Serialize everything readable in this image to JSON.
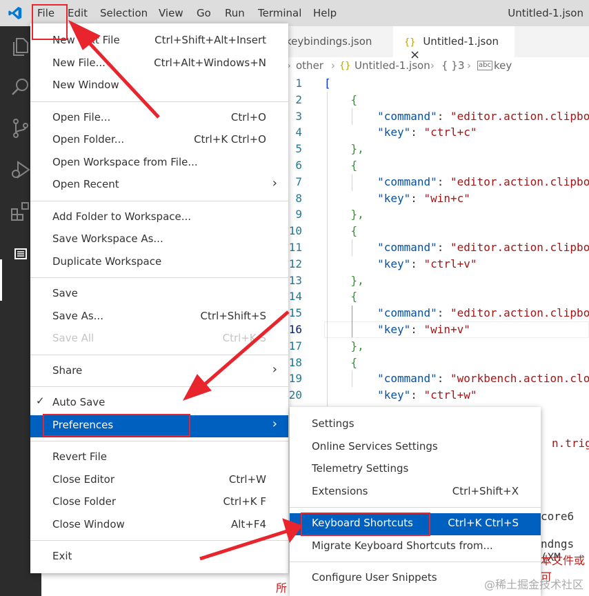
{
  "menubar": {
    "items": [
      "File",
      "Edit",
      "Selection",
      "View",
      "Go",
      "Run",
      "Terminal",
      "Help"
    ],
    "window_title": "Untitled-1.json"
  },
  "tabs": [
    {
      "label": "keybindings.json"
    },
    {
      "label": "Untitled-1.json",
      "icon_text": "{}",
      "close": "×"
    }
  ],
  "breadcrumb": {
    "items": [
      "other",
      "Untitled-1.json",
      "3",
      "key"
    ],
    "file_icon": "{}",
    "obj_icon": "{ }",
    "key_icon": "abc"
  },
  "editor": {
    "lines": [
      {
        "n": "1",
        "text": "["
      },
      {
        "n": "2",
        "text": "    {"
      },
      {
        "n": "3",
        "key": "\"command\"",
        "val": "\"editor.action.clipbo"
      },
      {
        "n": "4",
        "key": "\"key\"",
        "val": "\"ctrl+c\""
      },
      {
        "n": "5",
        "text": "    },"
      },
      {
        "n": "6",
        "text": "    {"
      },
      {
        "n": "7",
        "key": "\"command\"",
        "val": "\"editor.action.clipbo"
      },
      {
        "n": "8",
        "key": "\"key\"",
        "val": "\"win+c\""
      },
      {
        "n": "9",
        "text": "    },"
      },
      {
        "n": "10",
        "text": "    {"
      },
      {
        "n": "11",
        "key": "\"command\"",
        "val": "\"editor.action.clipbo"
      },
      {
        "n": "12",
        "key": "\"key\"",
        "val": "\"ctrl+v\""
      },
      {
        "n": "13",
        "text": "    },"
      },
      {
        "n": "14",
        "text": "    {"
      },
      {
        "n": "15",
        "key": "\"command\"",
        "val": "\"editor.action.clipbo"
      },
      {
        "n": "16",
        "key": "\"key\"",
        "val": "\"win+v\""
      },
      {
        "n": "17",
        "text": "    },"
      },
      {
        "n": "18",
        "text": "    {"
      },
      {
        "n": "19",
        "key": "\"command\"",
        "val": "\"workbench.action.clo"
      },
      {
        "n": "20",
        "key": "\"key\"",
        "val": "\"ctrl+w\""
      }
    ],
    "current_line": "16",
    "partial_trigger": "n.trigge",
    "partial_core": "core6",
    "partial_ndngs": "ndngs (XM",
    "partial_cn": "本文件或可",
    "partial_cn2": "所"
  },
  "file_menu": {
    "groups": [
      [
        {
          "label": "New Text File",
          "shortcut": "Ctrl+Shift+Alt+Insert"
        },
        {
          "label": "New File...",
          "shortcut": "Ctrl+Alt+Windows+N"
        },
        {
          "label": "New Window",
          "shortcut": ""
        }
      ],
      [
        {
          "label": "Open File...",
          "shortcut": "Ctrl+O"
        },
        {
          "label": "Open Folder...",
          "shortcut": "Ctrl+K Ctrl+O"
        },
        {
          "label": "Open Workspace from File...",
          "shortcut": ""
        },
        {
          "label": "Open Recent",
          "shortcut": "",
          "submenu": true
        }
      ],
      [
        {
          "label": "Add Folder to Workspace...",
          "shortcut": ""
        },
        {
          "label": "Save Workspace As...",
          "shortcut": ""
        },
        {
          "label": "Duplicate Workspace",
          "shortcut": ""
        }
      ],
      [
        {
          "label": "Save",
          "shortcut": ""
        },
        {
          "label": "Save As...",
          "shortcut": "Ctrl+Shift+S"
        },
        {
          "label": "Save All",
          "shortcut": "Ctrl+K S",
          "disabled": true
        }
      ],
      [
        {
          "label": "Share",
          "shortcut": "",
          "submenu": true
        }
      ],
      [
        {
          "label": "Auto Save",
          "shortcut": "",
          "checked": true
        },
        {
          "label": "Preferences",
          "shortcut": "",
          "submenu": true,
          "highlighted": true
        }
      ],
      [
        {
          "label": "Revert File",
          "shortcut": ""
        },
        {
          "label": "Close Editor",
          "shortcut": "Ctrl+W"
        },
        {
          "label": "Close Folder",
          "shortcut": "Ctrl+K F"
        },
        {
          "label": "Close Window",
          "shortcut": "Alt+F4"
        }
      ],
      [
        {
          "label": "Exit",
          "shortcut": ""
        }
      ]
    ],
    "check_mark": "✓",
    "submenu_arrow": "›"
  },
  "preferences_menu": {
    "groups": [
      [
        {
          "label": "Settings",
          "shortcut": ""
        },
        {
          "label": "Online Services Settings",
          "shortcut": ""
        },
        {
          "label": "Telemetry Settings",
          "shortcut": ""
        },
        {
          "label": "Extensions",
          "shortcut": "Ctrl+Shift+X"
        }
      ],
      [
        {
          "label": "Keyboard Shortcuts",
          "shortcut": "Ctrl+K Ctrl+S",
          "highlighted": true
        },
        {
          "label": "Migrate Keyboard Shortcuts from...",
          "shortcut": ""
        }
      ],
      [
        {
          "label": "Configure User Snippets",
          "shortcut": ""
        }
      ]
    ]
  },
  "watermark": "@稀土掘金技术社区",
  "colors": {
    "annotation_red": "#e8242c",
    "highlight_blue": "#0060c0"
  }
}
